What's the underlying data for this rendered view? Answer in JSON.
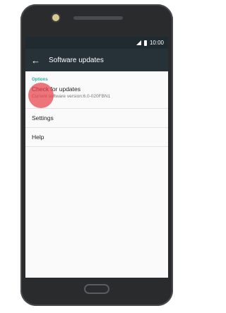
{
  "status_bar": {
    "time": "10:00"
  },
  "toolbar": {
    "title": "Software updates"
  },
  "section": {
    "header": "Options"
  },
  "items": [
    {
      "label": "Check for updates",
      "subtitle": "Current software version:6.0-020FBN1"
    },
    {
      "label": "Settings"
    },
    {
      "label": "Help"
    }
  ],
  "colors": {
    "toolbar": "#263238",
    "status_bar": "#1f2b30",
    "accent": "#2ab0a0",
    "touch_indicator": "#e84048"
  }
}
